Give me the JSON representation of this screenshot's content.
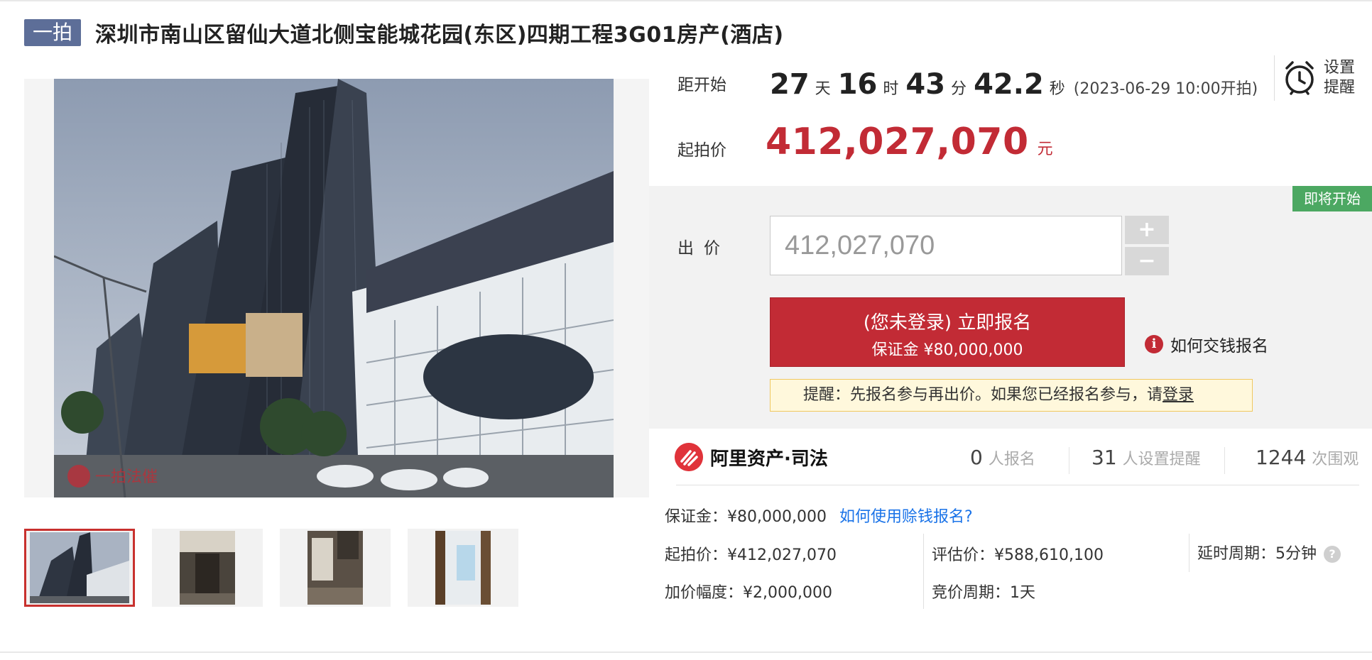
{
  "header": {
    "auction_tag": "一拍",
    "title": "深圳市南山区留仙大道北侧宝能城花园(东区)四期工程3G01房产(酒店)"
  },
  "gallery": {
    "main_image_watermark": "一拍法催",
    "zoom_icon": "magnifier-icon",
    "thumbnails": [
      {
        "name": "thumbnail-1",
        "active": true
      },
      {
        "name": "thumbnail-2",
        "active": false
      },
      {
        "name": "thumbnail-3",
        "active": false
      },
      {
        "name": "thumbnail-4",
        "active": false
      }
    ]
  },
  "countdown": {
    "label": "距开始",
    "days": "27",
    "days_unit": "天",
    "hours": "16",
    "hours_unit": "时",
    "minutes": "43",
    "minutes_unit": "分",
    "seconds": "42.2",
    "seconds_unit": "秒",
    "start_note": "(2023-06-29 10:00开拍)"
  },
  "reminder": {
    "icon": "alarm-clock-icon",
    "label_line1": "设置",
    "label_line2": "提醒"
  },
  "start_price": {
    "label": "起拍价",
    "value": "412,027,070",
    "unit": "元"
  },
  "bid": {
    "status_badge": "即将开始",
    "label": "出价",
    "input_value": "412,027,070",
    "plus": "+",
    "minus": "−",
    "signup_main": "(您未登录) 立即报名",
    "signup_deposit": "保证金 ¥80,000,000",
    "howpay": "如何交钱报名",
    "notice_text": "提醒：先报名参与再出价。如果您已经报名参与，请",
    "notice_link": "登录"
  },
  "brand": {
    "name": "阿里资产·司法"
  },
  "stats": [
    {
      "value": "0",
      "label": "人报名"
    },
    {
      "value": "31",
      "label": "人设置提醒"
    },
    {
      "value": "1244",
      "label": "次围观"
    }
  ],
  "details": {
    "deposit": "保证金：¥80,000,000",
    "deposit_link": "如何使用赊钱报名?",
    "start_price": "起拍价：¥412,027,070",
    "appraisal": "评估价：¥588,610,100",
    "delay_period": "延时周期：5分钟",
    "increment": "加价幅度：¥2,000,000",
    "bid_period": "竞价周期：1天"
  },
  "colors": {
    "accent_red": "#c22b35",
    "tag_blue": "#5d6e98",
    "badge_green": "#4ca862",
    "link_blue": "#1a73e8"
  }
}
